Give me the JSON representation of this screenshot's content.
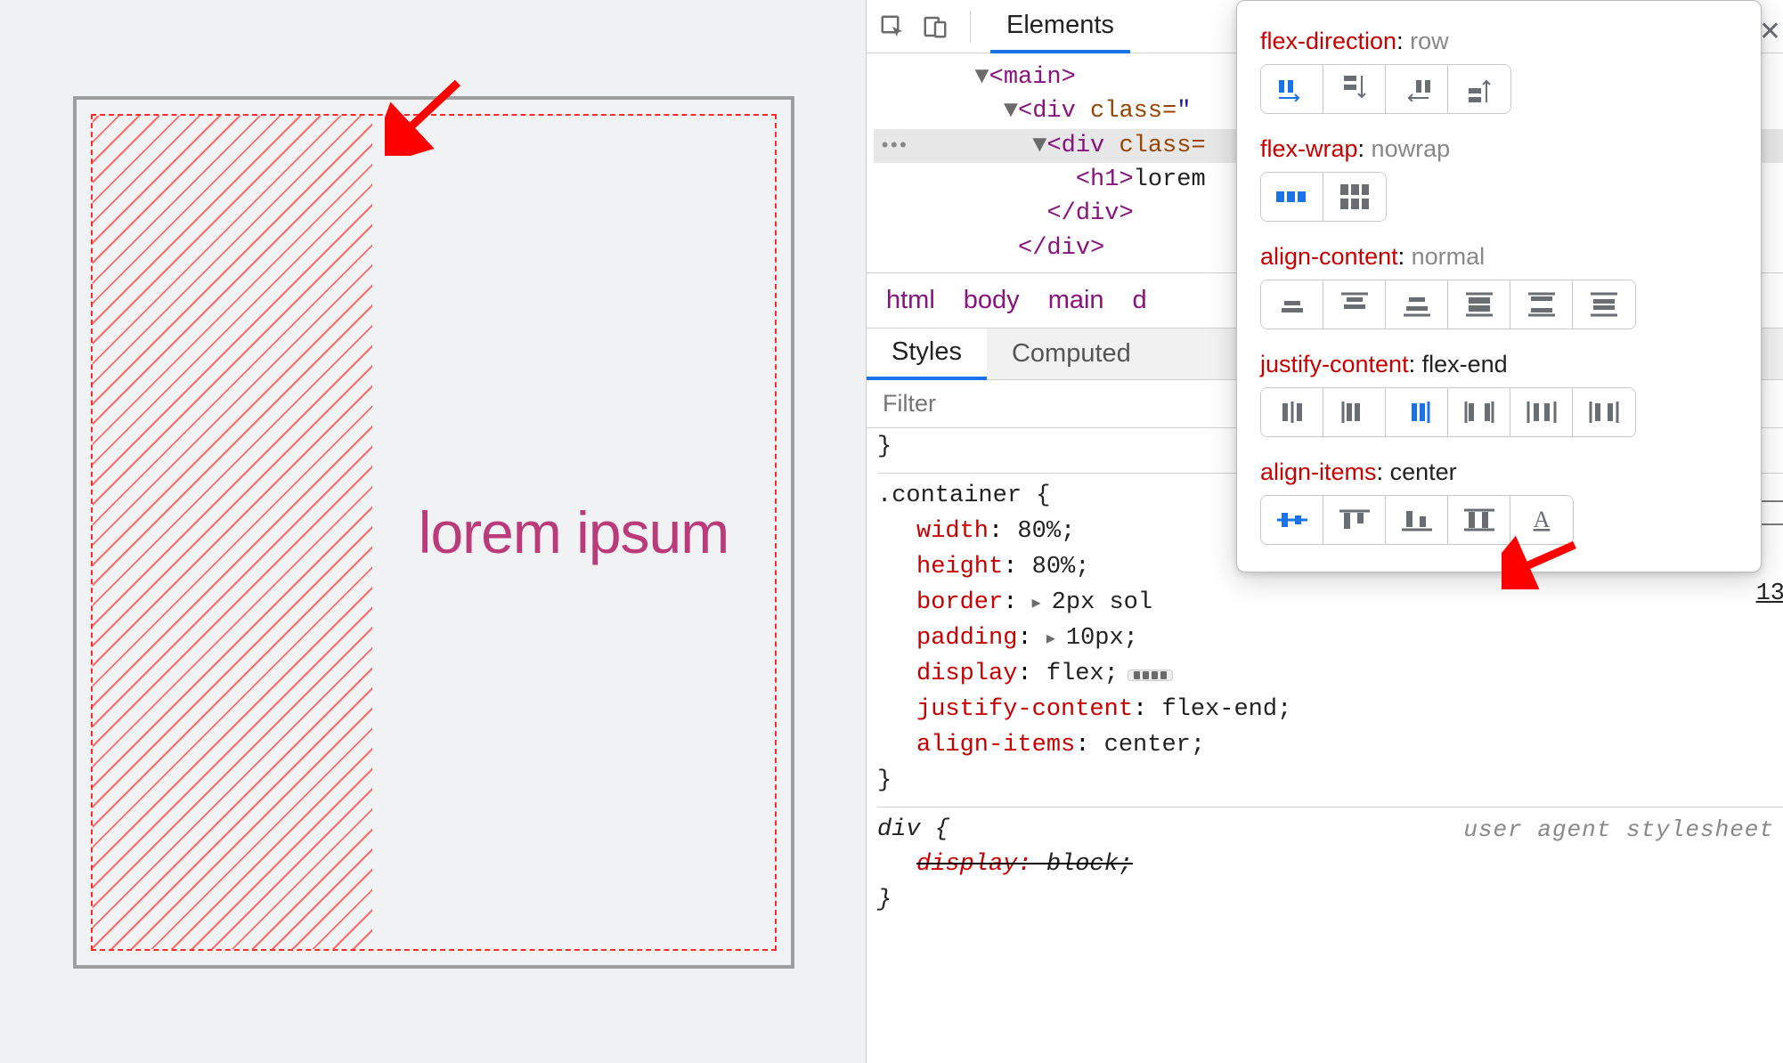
{
  "preview": {
    "heading": "lorem ipsum"
  },
  "devtools": {
    "tabs": {
      "elements": "Elements"
    },
    "dom": {
      "main": "<main>",
      "div1_open": "<div ",
      "div1_cls": "class=",
      "div1_q": "\"",
      "div2_open": "<div ",
      "div2_cls": "class=",
      "h1_open": "<h1>",
      "h1_text": "lorem",
      "div_close": "</div>",
      "div_close2": "</div>"
    },
    "breadcrumb": [
      "html",
      "body",
      "main",
      "d"
    ],
    "style_tabs": {
      "styles": "Styles",
      "computed": "Computed"
    },
    "filter_placeholder": "Filter",
    "rule_brace_close": "}",
    "rules": {
      "container": {
        "selector": ".container {",
        "decls": [
          {
            "prop": "width",
            "val": "80%;"
          },
          {
            "prop": "height",
            "val": "80%;"
          },
          {
            "prop": "border",
            "val": "2px sol",
            "tri": true
          },
          {
            "prop": "padding",
            "val": "10px;",
            "tri": true
          },
          {
            "prop": "display",
            "val": "flex;",
            "badge": true
          },
          {
            "prop": "justify-content",
            "val": "flex-end;"
          },
          {
            "prop": "align-items",
            "val": "center;"
          }
        ],
        "close": "}"
      },
      "div": {
        "selector": "div {",
        "ua": "user agent stylesheet",
        "decl_prop": "display:",
        "decl_val": " block;",
        "close": "}"
      }
    },
    "link_num": "13"
  },
  "popover": {
    "rows": [
      {
        "prop": "flex-direction",
        "val": "row",
        "grey": true,
        "icons": "fd",
        "selected": 0,
        "count": 4
      },
      {
        "prop": "flex-wrap",
        "val": "nowrap",
        "grey": true,
        "icons": "fw",
        "selected": 0,
        "count": 2
      },
      {
        "prop": "align-content",
        "val": "normal",
        "grey": true,
        "icons": "ac",
        "selected": -1,
        "count": 6
      },
      {
        "prop": "justify-content",
        "val": "flex-end",
        "grey": false,
        "icons": "jc",
        "selected": 2,
        "count": 6
      },
      {
        "prop": "align-items",
        "val": "center",
        "grey": false,
        "icons": "ai",
        "selected": 0,
        "count": 5
      }
    ]
  }
}
